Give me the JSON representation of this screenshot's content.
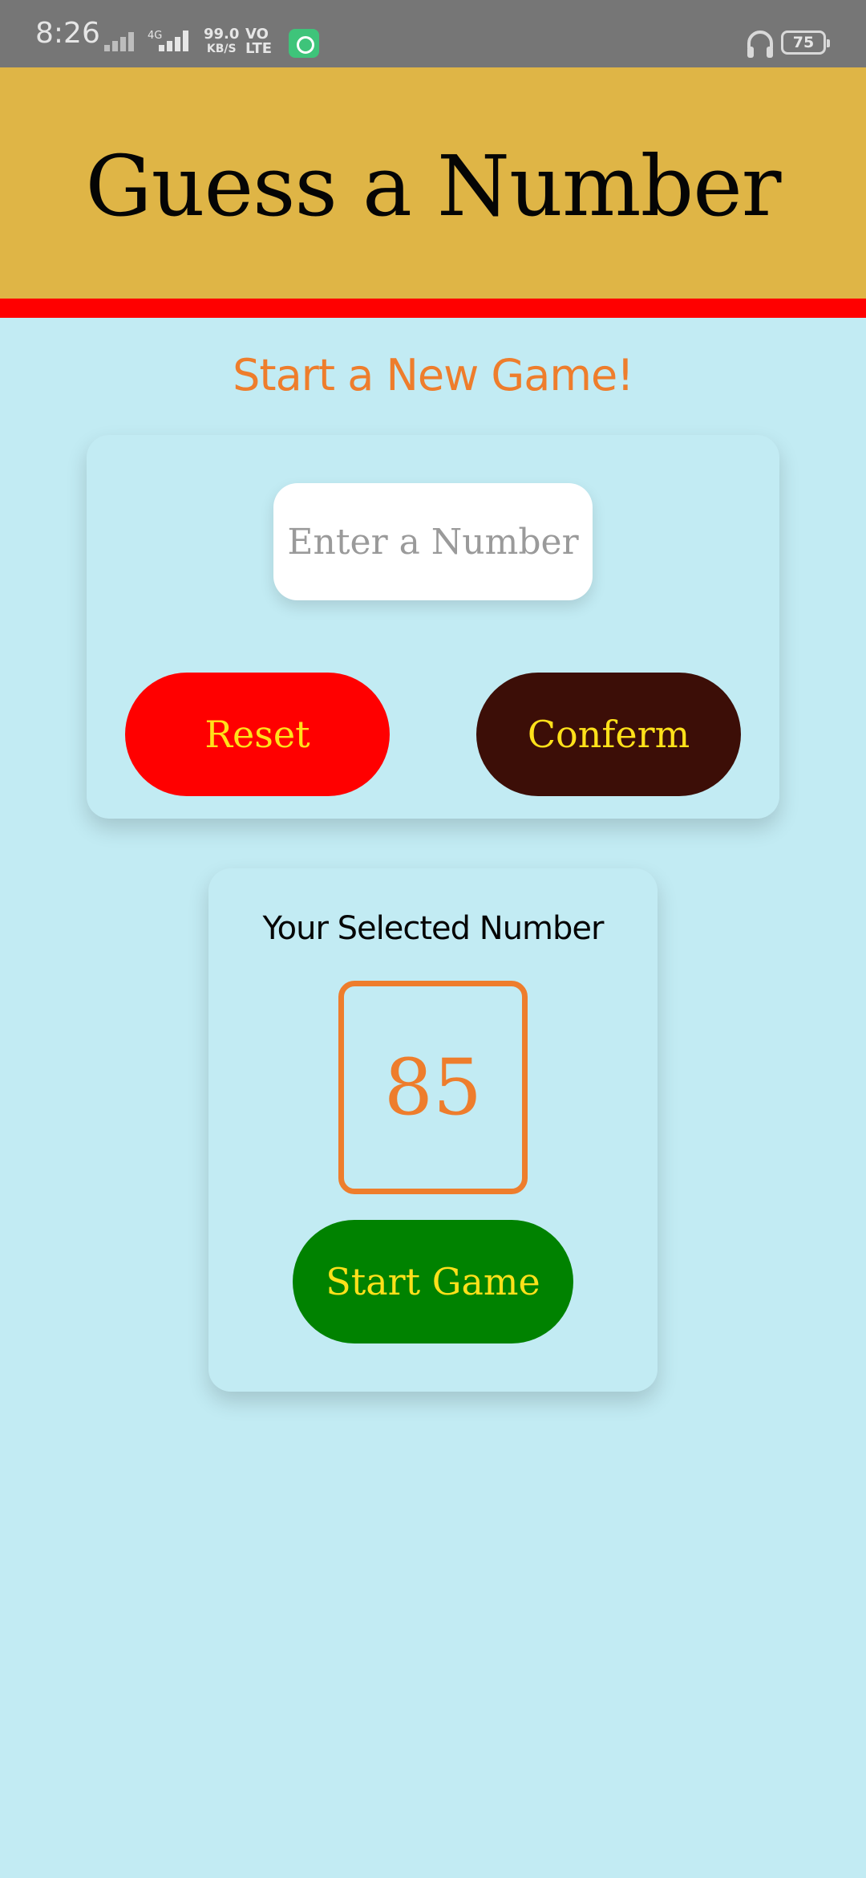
{
  "status_bar": {
    "time": "8:26",
    "network_label": "4G",
    "speed_value": "99.0",
    "speed_unit": "KB/S",
    "volte_line1": "VO",
    "volte_line2": "LTE",
    "battery_level": "75"
  },
  "header": {
    "title": "Guess a Number",
    "background_color": "#dfb546",
    "stripe_color": "#ff0000"
  },
  "start_screen": {
    "subtitle": "Start a New Game!",
    "input": {
      "placeholder": "Enter a Number",
      "value": ""
    },
    "reset_label": "Reset",
    "confirm_label": "Conferm"
  },
  "selected_panel": {
    "title": "Your Selected Number",
    "number": "85",
    "start_label": "Start Game"
  },
  "colors": {
    "background": "#c2ebf3",
    "accent_orange": "#ee7d2c",
    "button_text": "#ffe11a",
    "reset_button": "#ff0000",
    "confirm_button": "#3c0e07",
    "start_button": "#008200"
  },
  "icons": [
    "signal-icon",
    "headphone-icon",
    "battery-icon",
    "app-notification-icon"
  ]
}
